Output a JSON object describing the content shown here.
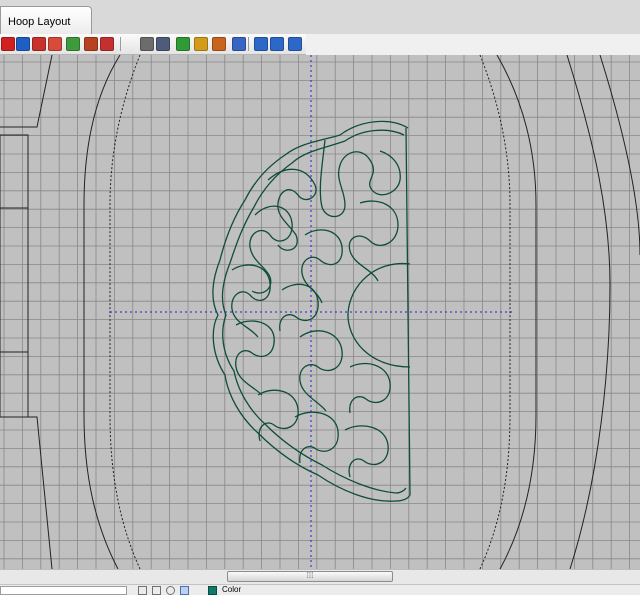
{
  "tab": {
    "title": "Hoop Layout"
  },
  "toolbar": {
    "buttons": [
      {
        "name": "grid-icon",
        "color": "#d22020"
      },
      {
        "name": "hoop-icon",
        "color": "#1f5fc4"
      },
      {
        "name": "select-icon",
        "color": "#c8322a"
      },
      {
        "name": "stitch-points-icon",
        "color": "#d84a3a"
      },
      {
        "name": "color-blocks-icon",
        "color": "#3d9a3d"
      },
      {
        "name": "realistic-view-icon",
        "color": "#b8421f"
      },
      {
        "name": "jump-stitches-icon",
        "color": "#c43030"
      },
      {
        "name": "layers-icon",
        "color": "#6c6c6c"
      },
      {
        "name": "align-icon",
        "color": "#4e5b7a"
      },
      {
        "name": "color-select-icon",
        "color": "#2f9a36"
      },
      {
        "name": "color-sequence-icon",
        "color": "#d49b1a"
      },
      {
        "name": "person-icon",
        "color": "#c8641e"
      },
      {
        "name": "pattern-icon",
        "color": "#3864c4"
      },
      {
        "name": "zoom-in-icon",
        "color": "#2c68c8"
      },
      {
        "name": "zoom-out-icon",
        "color": "#2c68c8"
      },
      {
        "name": "zoom-fit-icon",
        "color": "#2c68c8"
      }
    ]
  },
  "colors": {
    "grid": "#888888",
    "canvas": "#c0c0c0",
    "design": "#0f4d3a",
    "guide": "#2020cc",
    "hoop": "#222222"
  },
  "statusbar": {
    "color_label": "Color"
  }
}
